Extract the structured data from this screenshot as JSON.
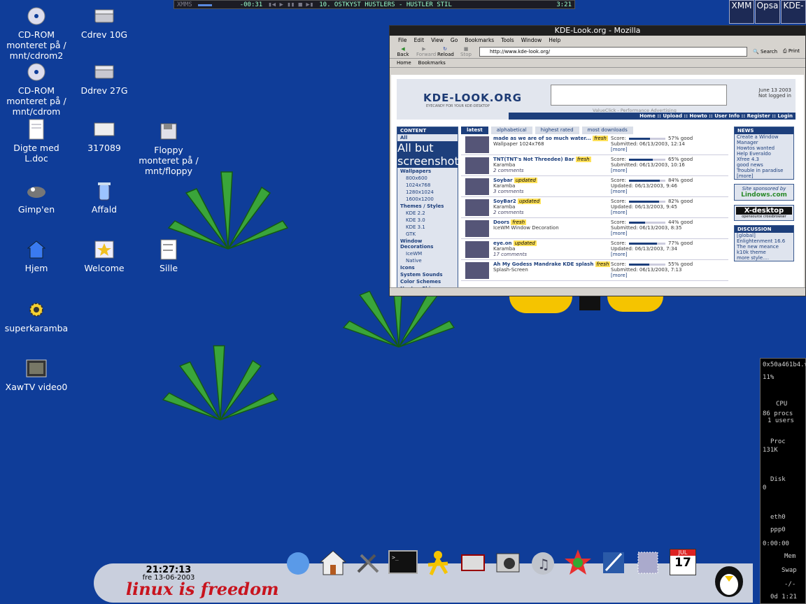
{
  "desktop": {
    "icons": [
      {
        "label": "CD-ROM monteret på / mnt/cdrom2"
      },
      {
        "label": "Cdrev 10G"
      },
      {
        "label": "CD-ROM monteret på / mnt/cdrom"
      },
      {
        "label": "Ddrev 27G"
      },
      {
        "label": "Digte med L.doc"
      },
      {
        "label": "317089"
      },
      {
        "label": "Floppy monteret på / mnt/floppy"
      },
      {
        "label": "Gimp'en"
      },
      {
        "label": "Affald"
      },
      {
        "label": "Hjem"
      },
      {
        "label": "Welcome"
      },
      {
        "label": "Sille"
      },
      {
        "label": "superkaramba"
      },
      {
        "label": "XawTV video0"
      }
    ],
    "background_color": "#0f3d99"
  },
  "xmms": {
    "buttons": "XMMS",
    "time": "-00:31",
    "track": "10. OSTKYST HUSTLERS - HUSTLER STIL",
    "duration": "3:21"
  },
  "tray": {
    "items": [
      "XMM",
      "Opsa",
      "KDE-"
    ]
  },
  "browser": {
    "title": "KDE-Look.org - Mozilla",
    "menu": [
      "File",
      "Edit",
      "View",
      "Go",
      "Bookmarks",
      "Tools",
      "Window",
      "Help"
    ],
    "nav": [
      "Back",
      "Forward",
      "Reload",
      "Stop"
    ],
    "url": "http://www.kde-look.org/",
    "search_label": "Search",
    "print_label": "Print",
    "personal_bar": [
      "Home",
      "Bookmarks"
    ],
    "page": {
      "logo": "KDE-LOOK.ORG",
      "tagline": "EYECANDY FOR YOUR KDE-DESKTOP",
      "date": "June 13 2003",
      "login_status": "Not logged in",
      "ad_note": "ValueClick - Performance Advertising",
      "top_links": "Home :: Upload :: Howto :: User Info :: Register :: Login",
      "sidebar_title": "CONTENT",
      "sidebar_items": [
        {
          "label": "All",
          "kind": "it"
        },
        {
          "label": "All but screenshots",
          "kind": "sel"
        },
        {
          "label": "Wallpapers",
          "kind": "it"
        },
        {
          "label": "800x600",
          "kind": "sub"
        },
        {
          "label": "1024x768",
          "kind": "sub"
        },
        {
          "label": "1280x1024",
          "kind": "sub"
        },
        {
          "label": "1600x1200",
          "kind": "sub"
        },
        {
          "label": "Themes / Styles",
          "kind": "it"
        },
        {
          "label": "KDE 2.2",
          "kind": "sub"
        },
        {
          "label": "KDE 3.0",
          "kind": "sub"
        },
        {
          "label": "KDE 3.1",
          "kind": "sub"
        },
        {
          "label": "GTK",
          "kind": "sub"
        },
        {
          "label": "Window Decorations",
          "kind": "it"
        },
        {
          "label": "IceWM",
          "kind": "sub"
        },
        {
          "label": "Native",
          "kind": "sub"
        },
        {
          "label": "Icons",
          "kind": "it"
        },
        {
          "label": "System Sounds",
          "kind": "it"
        },
        {
          "label": "Color Schemes",
          "kind": "it"
        },
        {
          "label": "Noatun Skins",
          "kind": "it"
        }
      ],
      "tabs": [
        "latest",
        "alphabetical",
        "highest rated",
        "most downloads"
      ],
      "entries": [
        {
          "title": "made as we are of so much water...",
          "tag": "fresh",
          "desc": "Wallpaper 1024x768",
          "comments": "",
          "score": 57,
          "score_text": "57% good",
          "submitted": "Submitted: 06/13/2003, 12:14",
          "more": "[more]"
        },
        {
          "title": "TNT(TNT's Not Threedee) Bar",
          "tag": "fresh",
          "desc": "Karamba",
          "comments": "2 comments",
          "score": 65,
          "score_text": "65% good",
          "submitted": "Submitted: 06/13/2003, 10:16",
          "more": "[more]"
        },
        {
          "title": "Soybar",
          "tag": "updated",
          "desc": "Karamba",
          "comments": "3 comments",
          "score": 84,
          "score_text": "84% good",
          "submitted": "Updated: 06/13/2003, 9:46",
          "more": "[more]"
        },
        {
          "title": "SoyBar2",
          "tag": "updated",
          "desc": "Karamba",
          "comments": "2 comments",
          "score": 82,
          "score_text": "82% good",
          "submitted": "Updated: 06/13/2003, 9:45",
          "more": "[more]"
        },
        {
          "title": "Doors",
          "tag": "fresh",
          "desc": "IceWM Window Decoration",
          "comments": "",
          "score": 44,
          "score_text": "44% good",
          "submitted": "Submitted: 06/13/2003, 8:35",
          "more": "[more]"
        },
        {
          "title": "eye.on",
          "tag": "updated",
          "desc": "Karamba",
          "comments": "17 comments",
          "score": 77,
          "score_text": "77% good",
          "submitted": "Updated: 06/13/2003, 7:34",
          "more": "[more]"
        },
        {
          "title": "Ah My Godess Mandrake KDE splash",
          "tag": "fresh",
          "desc": "Splash-Screen",
          "comments": "",
          "score": 55,
          "score_text": "55% good",
          "submitted": "Submitted: 06/13/2003, 7:13",
          "more": "[more]"
        }
      ],
      "score_label": "Score:",
      "news_title": "NEWS",
      "news": [
        "Create a Window Manager",
        "Howtos wanted",
        "Help Everaldo",
        "Xfree 4.3",
        "good news",
        "Trouble in paradise",
        "[more]"
      ],
      "sponsor": "Site sponsored by",
      "sponsor_name": "Lindows.com",
      "xdesktop": "X-desktop",
      "xdesktop_sub": "opensource crossbrowser",
      "discussion_title": "DISCUSSION",
      "discussion": [
        "[global]",
        "Enlightenment 16.6",
        "The new meance",
        "k10k theme",
        "more style...."
      ]
    }
  },
  "sysmon": {
    "host": "0x50a461b4.v",
    "cpu_pct": "11%",
    "cpu_label": "CPU",
    "procs": "86 procs",
    "users": "1 users",
    "proc_label": "Proc",
    "mem": "131K",
    "disk_label": "Disk",
    "disk_val": "0",
    "eth": "eth0",
    "ppp": "ppp0",
    "timer": "0:00:00",
    "mem_label": "Mem",
    "swap_label": "Swap",
    "mail": "-/-",
    "uptime": "0d 1:21"
  },
  "panel": {
    "time": "21:27:13",
    "date": "fre 13-06-2003",
    "slogan": "linux is freedom",
    "calendar_day": "17",
    "calendar_month": "JUL"
  }
}
